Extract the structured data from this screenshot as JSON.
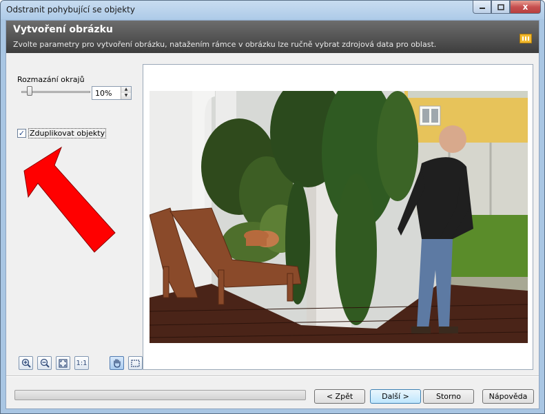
{
  "window": {
    "title": "Odstranit pohybující se objekty",
    "controls": {
      "minimize_icon": "minimize-icon",
      "maximize_icon": "maximize-icon",
      "close_label": "x"
    }
  },
  "header": {
    "title": "Vytvoření obrázku",
    "subtitle": "Zvolte parametry pro vytvoření obrázku, natažením rámce v obrázku lze ručně vybrat zdrojová data pro oblast.",
    "icon": "grid-image-icon"
  },
  "settings": {
    "blur_label": "Rozmazání okrajů",
    "blur_value": "10%",
    "blur_level_percent": 10,
    "duplicate_label": "Zduplikovat objekty",
    "duplicate_checked": true
  },
  "annotation": {
    "arrow_color": "#ff0000"
  },
  "toolbar": {
    "zoom_in_icon": "zoom-in-icon",
    "zoom_out_icon": "zoom-out-icon",
    "fit_icon": "fit-to-window-icon",
    "actual_size_label": "1:1",
    "pan_icon": "hand-icon",
    "select_icon": "selection-rectangle-icon"
  },
  "footer": {
    "back_label": "< Zpět",
    "next_label": "Další >",
    "cancel_label": "Storno",
    "help_label": "Nápověda"
  },
  "colors": {
    "header_bg": "#4a4a4a",
    "title_bar": "#aecbe8",
    "close_button": "#c75050"
  }
}
